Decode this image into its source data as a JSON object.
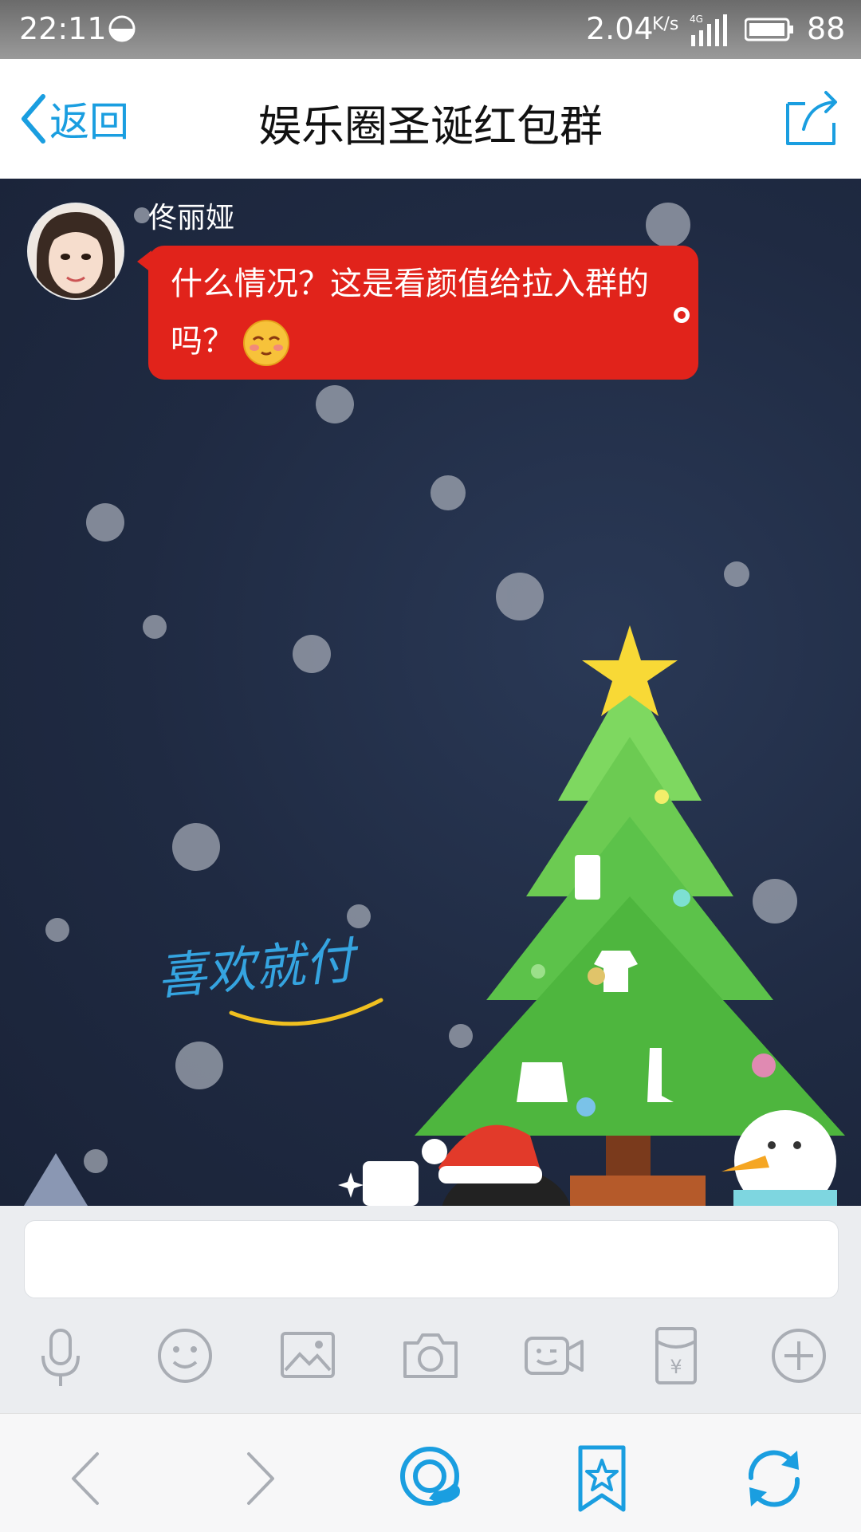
{
  "status_bar": {
    "time": "22:11",
    "network_speed": "2.04",
    "speed_unit": "K/s",
    "network_type": "4G",
    "battery_level": "88"
  },
  "header": {
    "back_label": "返回",
    "title": "娱乐圈圣诞红包群"
  },
  "chat": {
    "messages": [
      {
        "sender": "佟丽娅",
        "text_line1": "什么情况？这是看颜值给拉入群的",
        "text_line2": "吗？",
        "emoji": "blushing-face"
      }
    ],
    "background_text": "喜欢就付"
  },
  "input_bar": {
    "text_value": "",
    "tools": [
      "microphone-icon",
      "emoji-icon",
      "image-icon",
      "camera-icon",
      "video-call-icon",
      "red-packet-icon",
      "plus-icon"
    ]
  },
  "bottom_nav": {
    "items": [
      "back-icon",
      "forward-icon",
      "qq-icon",
      "favorites-icon",
      "refresh-icon"
    ]
  },
  "colors": {
    "accent": "#1a9ee0",
    "bubble": "#e1231b",
    "chat_bg": "#1f2a42",
    "tree": "#5cc24a"
  }
}
